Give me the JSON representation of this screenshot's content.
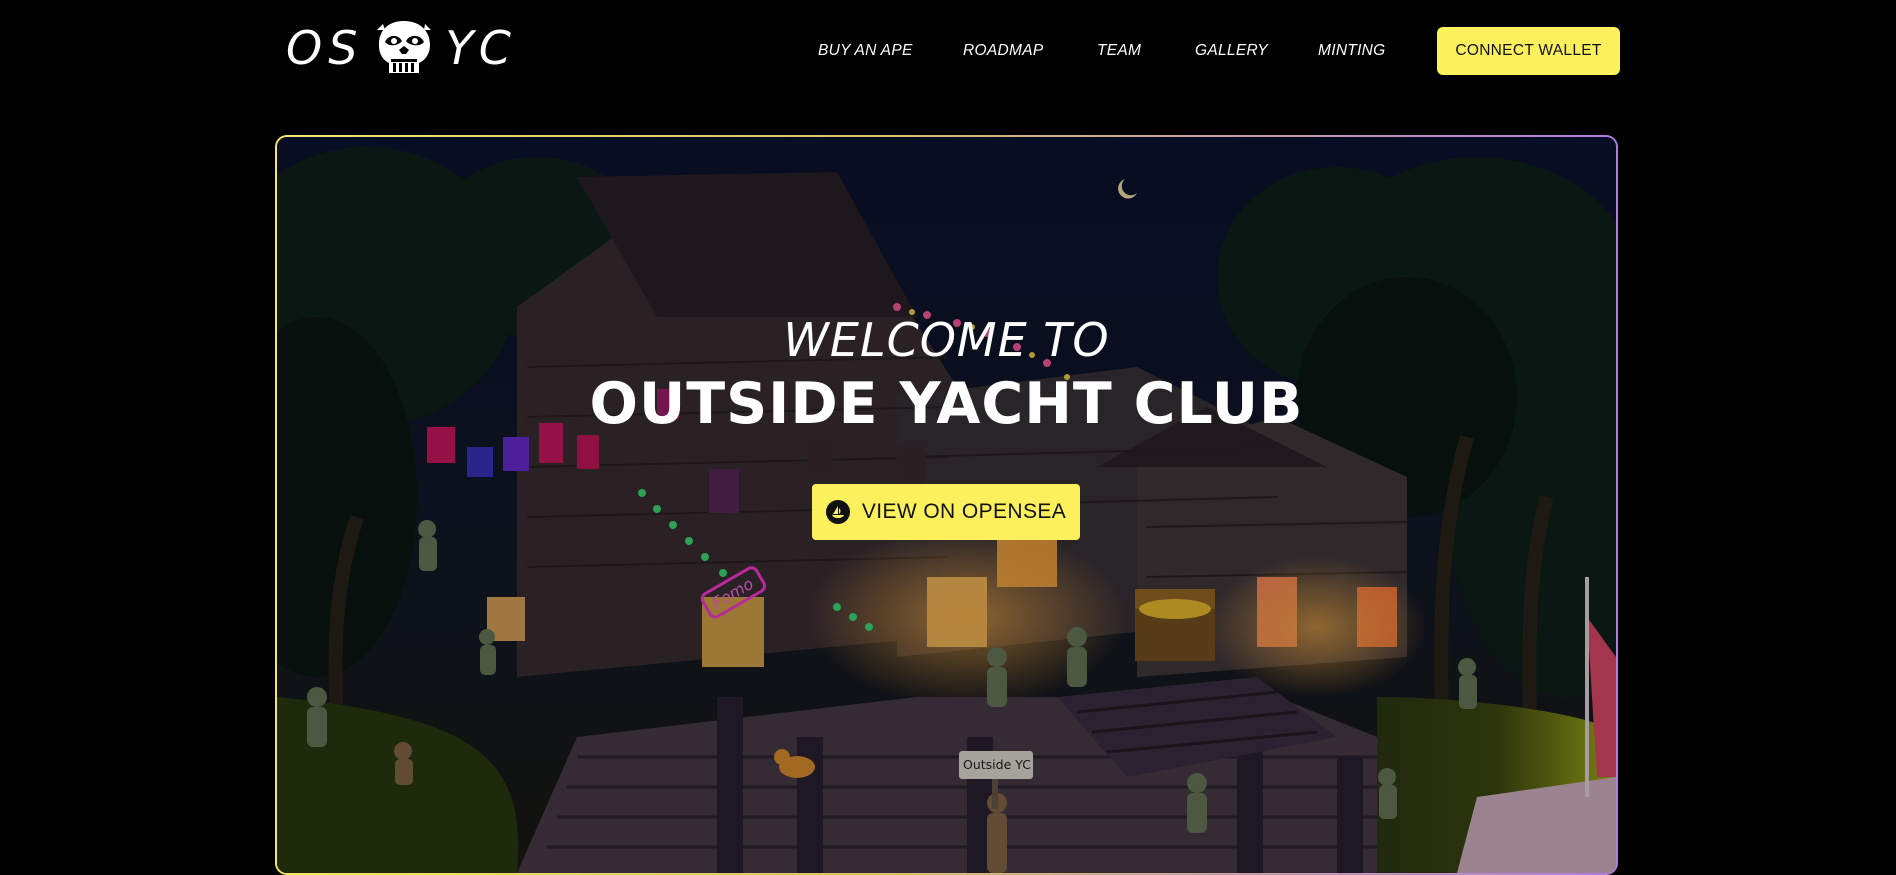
{
  "header": {
    "logo": {
      "left": "OS",
      "right": "YC",
      "icon": "ape-skull-icon"
    },
    "nav": [
      {
        "label": "BUY AN APE"
      },
      {
        "label": "ROADMAP"
      },
      {
        "label": "TEAM"
      },
      {
        "label": "GALLERY"
      },
      {
        "label": "MINTING"
      }
    ],
    "connect_label": "CONNECT WALLET"
  },
  "hero": {
    "welcome": "WELCOME TO",
    "title": "OUTSIDE YACHT CLUB",
    "cta_label": "VIEW ON OPENSEA",
    "cta_icon": "opensea-boat-icon",
    "sign_text": "Outside YC",
    "neon_sign": "Fomo"
  },
  "colors": {
    "background": "#000000",
    "accent": "#fcf15c",
    "border_start": "#f5e66a",
    "border_end": "#b07be0"
  }
}
